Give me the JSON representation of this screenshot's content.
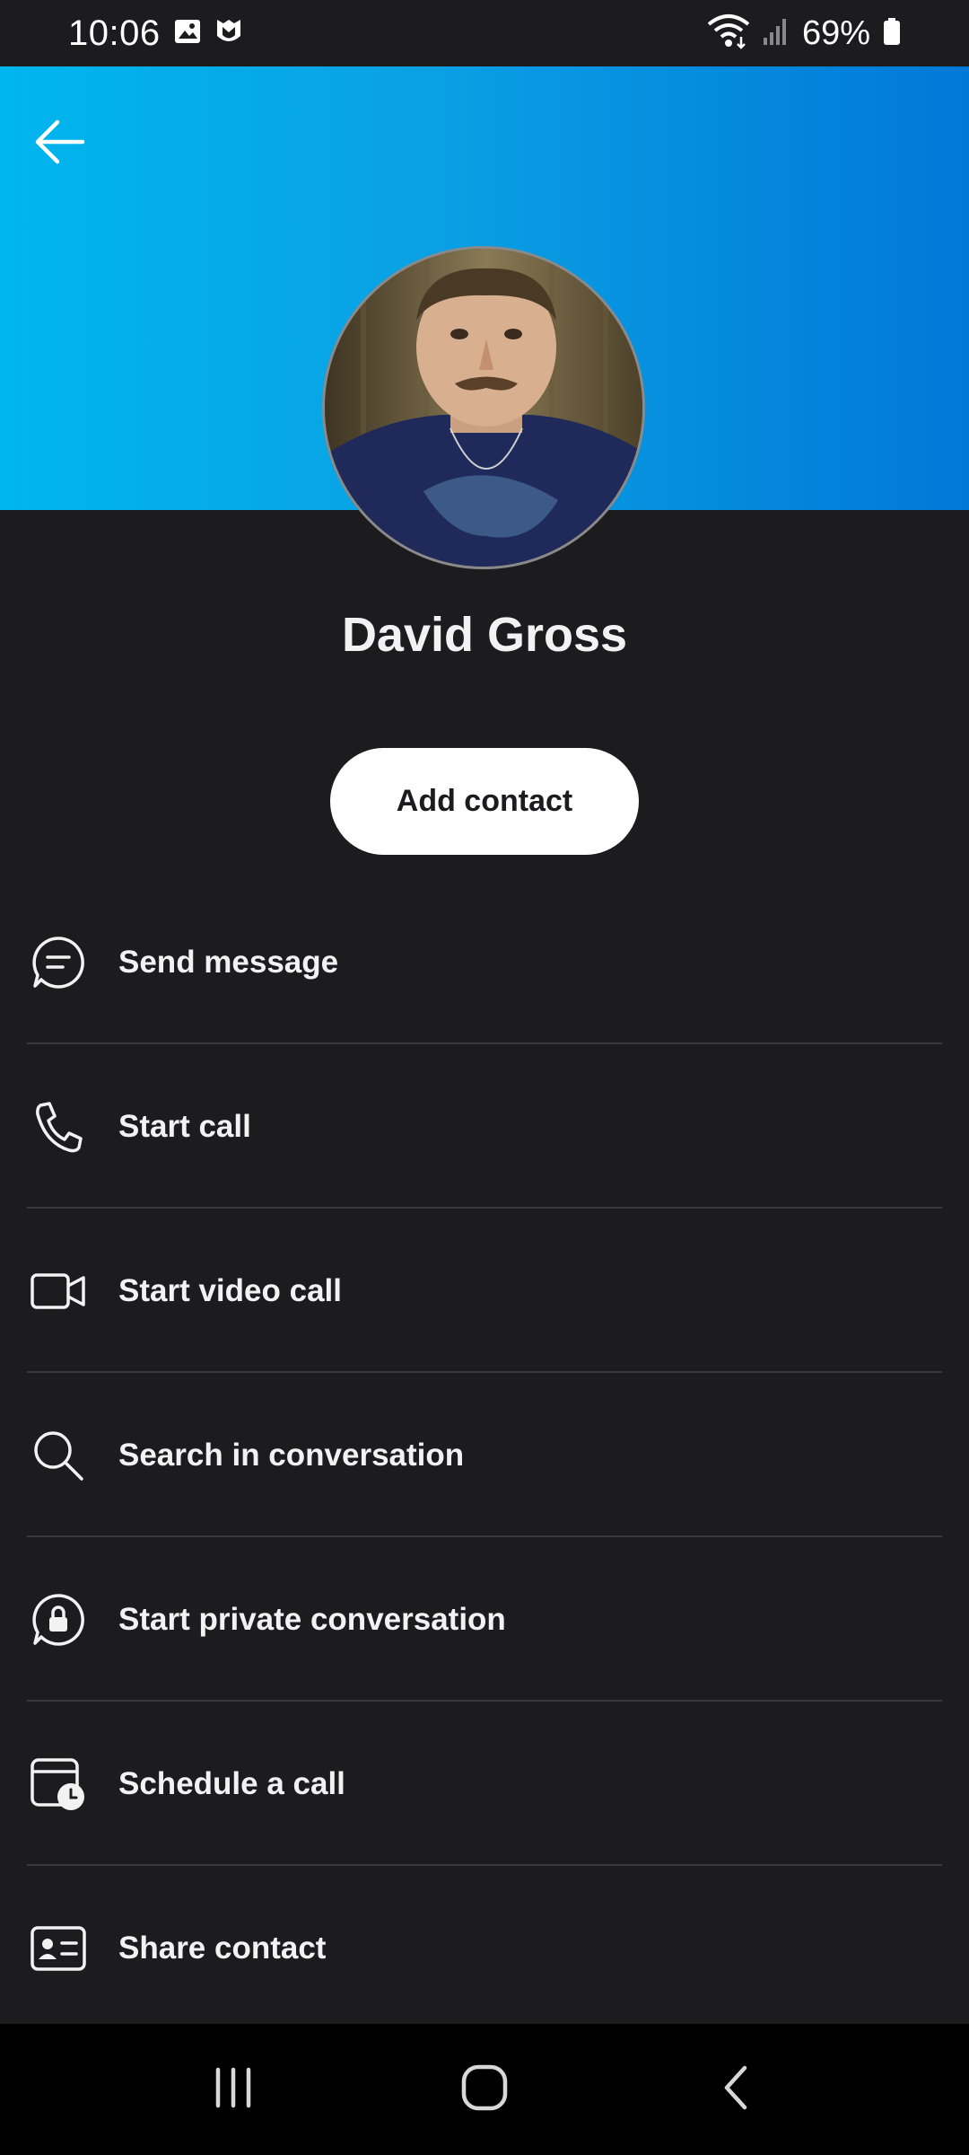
{
  "status_bar": {
    "time": "10:06",
    "battery": "69%"
  },
  "contact": {
    "name": "David Gross"
  },
  "add_contact_label": "Add contact",
  "actions": [
    {
      "label": "Send message",
      "icon": "message-icon"
    },
    {
      "label": "Start call",
      "icon": "phone-icon"
    },
    {
      "label": "Start video call",
      "icon": "video-icon"
    },
    {
      "label": "Search in conversation",
      "icon": "search-icon"
    },
    {
      "label": "Start private conversation",
      "icon": "lock-chat-icon"
    },
    {
      "label": "Schedule a call",
      "icon": "calendar-clock-icon"
    },
    {
      "label": "Share contact",
      "icon": "contact-card-icon"
    }
  ],
  "colors": {
    "header_gradient_start": "#00b6ee",
    "header_gradient_end": "#0078d7",
    "background": "#1c1c1e",
    "divider": "#3a3a3c"
  }
}
